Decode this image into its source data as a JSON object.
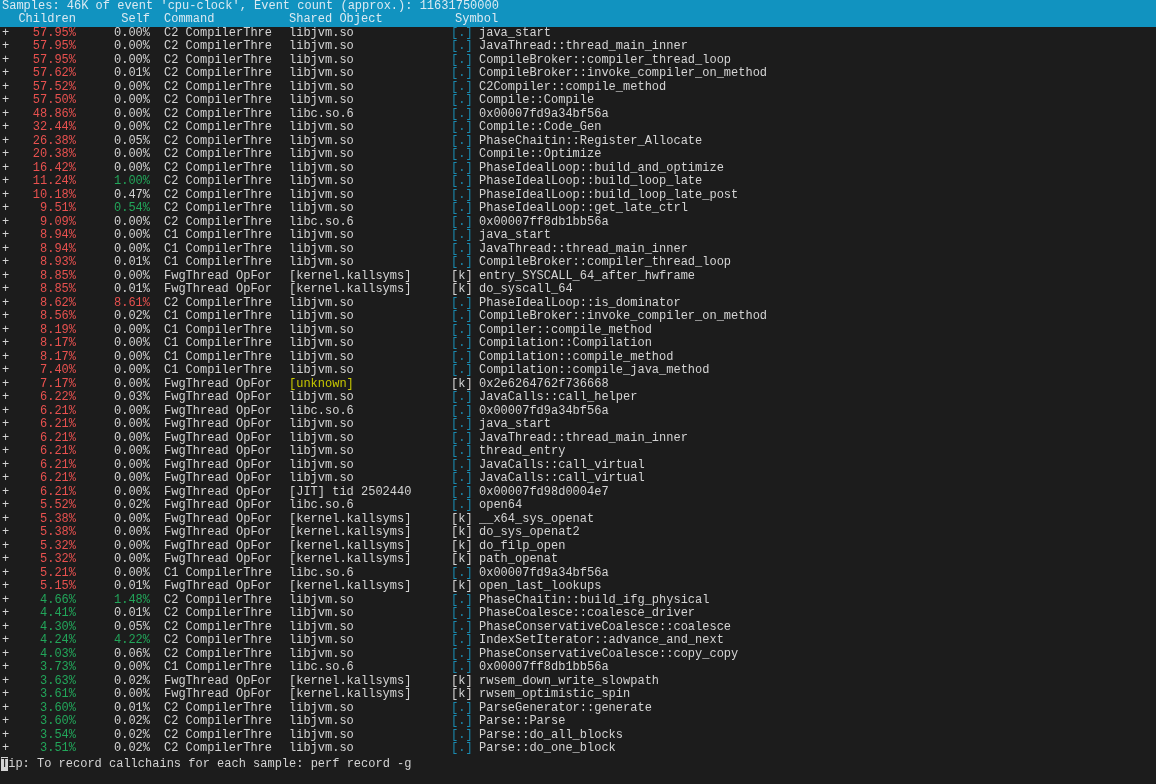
{
  "summary": "Samples: 46K of event 'cpu-clock', Event count (approx.): 11631750000",
  "columns": [
    "Children",
    "Self",
    "Command",
    "Shared Object",
    "Symbol"
  ],
  "rows": [
    {
      "marker": "+",
      "children": "57.95%",
      "children_high": true,
      "self": "0.00%",
      "self_high": false,
      "self_warm": false,
      "command": "C2 CompilerThre",
      "shared_object": "libjvm.so",
      "unknown_object": false,
      "symbol_type": "[.]",
      "kernel": false,
      "symbol": "java_start"
    },
    {
      "marker": "+",
      "children": "57.95%",
      "children_high": true,
      "self": "0.00%",
      "self_high": false,
      "self_warm": false,
      "command": "C2 CompilerThre",
      "shared_object": "libjvm.so",
      "unknown_object": false,
      "symbol_type": "[.]",
      "kernel": false,
      "symbol": "JavaThread::thread_main_inner"
    },
    {
      "marker": "+",
      "children": "57.95%",
      "children_high": true,
      "self": "0.00%",
      "self_high": false,
      "self_warm": false,
      "command": "C2 CompilerThre",
      "shared_object": "libjvm.so",
      "unknown_object": false,
      "symbol_type": "[.]",
      "kernel": false,
      "symbol": "CompileBroker::compiler_thread_loop"
    },
    {
      "marker": "+",
      "children": "57.62%",
      "children_high": true,
      "self": "0.01%",
      "self_high": false,
      "self_warm": false,
      "command": "C2 CompilerThre",
      "shared_object": "libjvm.so",
      "unknown_object": false,
      "symbol_type": "[.]",
      "kernel": false,
      "symbol": "CompileBroker::invoke_compiler_on_method"
    },
    {
      "marker": "+",
      "children": "57.52%",
      "children_high": true,
      "self": "0.00%",
      "self_high": false,
      "self_warm": false,
      "command": "C2 CompilerThre",
      "shared_object": "libjvm.so",
      "unknown_object": false,
      "symbol_type": "[.]",
      "kernel": false,
      "symbol": "C2Compiler::compile_method"
    },
    {
      "marker": "+",
      "children": "57.50%",
      "children_high": true,
      "self": "0.00%",
      "self_high": false,
      "self_warm": false,
      "command": "C2 CompilerThre",
      "shared_object": "libjvm.so",
      "unknown_object": false,
      "symbol_type": "[.]",
      "kernel": false,
      "symbol": "Compile::Compile"
    },
    {
      "marker": "+",
      "children": "48.86%",
      "children_high": true,
      "self": "0.00%",
      "self_high": false,
      "self_warm": false,
      "command": "C2 CompilerThre",
      "shared_object": "libc.so.6",
      "unknown_object": false,
      "symbol_type": "[.]",
      "kernel": false,
      "symbol": "0x00007fd9a34bf56a"
    },
    {
      "marker": "+",
      "children": "32.44%",
      "children_high": true,
      "self": "0.00%",
      "self_high": false,
      "self_warm": false,
      "command": "C2 CompilerThre",
      "shared_object": "libjvm.so",
      "unknown_object": false,
      "symbol_type": "[.]",
      "kernel": false,
      "symbol": "Compile::Code_Gen"
    },
    {
      "marker": "+",
      "children": "26.38%",
      "children_high": true,
      "self": "0.05%",
      "self_high": false,
      "self_warm": false,
      "command": "C2 CompilerThre",
      "shared_object": "libjvm.so",
      "unknown_object": false,
      "symbol_type": "[.]",
      "kernel": false,
      "symbol": "PhaseChaitin::Register_Allocate"
    },
    {
      "marker": "+",
      "children": "20.38%",
      "children_high": true,
      "self": "0.00%",
      "self_high": false,
      "self_warm": false,
      "command": "C2 CompilerThre",
      "shared_object": "libjvm.so",
      "unknown_object": false,
      "symbol_type": "[.]",
      "kernel": false,
      "symbol": "Compile::Optimize"
    },
    {
      "marker": "+",
      "children": "16.42%",
      "children_high": true,
      "self": "0.00%",
      "self_high": false,
      "self_warm": false,
      "command": "C2 CompilerThre",
      "shared_object": "libjvm.so",
      "unknown_object": false,
      "symbol_type": "[.]",
      "kernel": false,
      "symbol": "PhaseIdealLoop::build_and_optimize"
    },
    {
      "marker": "+",
      "children": "11.24%",
      "children_high": true,
      "self": "1.00%",
      "self_high": false,
      "self_warm": true,
      "command": "C2 CompilerThre",
      "shared_object": "libjvm.so",
      "unknown_object": false,
      "symbol_type": "[.]",
      "kernel": false,
      "symbol": "PhaseIdealLoop::build_loop_late"
    },
    {
      "marker": "+",
      "children": "10.18%",
      "children_high": true,
      "self": "0.47%",
      "self_high": false,
      "self_warm": false,
      "command": "C2 CompilerThre",
      "shared_object": "libjvm.so",
      "unknown_object": false,
      "symbol_type": "[.]",
      "kernel": false,
      "symbol": "PhaseIdealLoop::build_loop_late_post"
    },
    {
      "marker": "+",
      "children": "9.51%",
      "children_high": true,
      "self": "0.54%",
      "self_high": false,
      "self_warm": true,
      "command": "C2 CompilerThre",
      "shared_object": "libjvm.so",
      "unknown_object": false,
      "symbol_type": "[.]",
      "kernel": false,
      "symbol": "PhaseIdealLoop::get_late_ctrl"
    },
    {
      "marker": "+",
      "children": "9.09%",
      "children_high": true,
      "self": "0.00%",
      "self_high": false,
      "self_warm": false,
      "command": "C2 CompilerThre",
      "shared_object": "libc.so.6",
      "unknown_object": false,
      "symbol_type": "[.]",
      "kernel": false,
      "symbol": "0x00007ff8db1bb56a"
    },
    {
      "marker": "+",
      "children": "8.94%",
      "children_high": true,
      "self": "0.00%",
      "self_high": false,
      "self_warm": false,
      "command": "C1 CompilerThre",
      "shared_object": "libjvm.so",
      "unknown_object": false,
      "symbol_type": "[.]",
      "kernel": false,
      "symbol": "java_start"
    },
    {
      "marker": "+",
      "children": "8.94%",
      "children_high": true,
      "self": "0.00%",
      "self_high": false,
      "self_warm": false,
      "command": "C1 CompilerThre",
      "shared_object": "libjvm.so",
      "unknown_object": false,
      "symbol_type": "[.]",
      "kernel": false,
      "symbol": "JavaThread::thread_main_inner"
    },
    {
      "marker": "+",
      "children": "8.93%",
      "children_high": true,
      "self": "0.01%",
      "self_high": false,
      "self_warm": false,
      "command": "C1 CompilerThre",
      "shared_object": "libjvm.so",
      "unknown_object": false,
      "symbol_type": "[.]",
      "kernel": false,
      "symbol": "CompileBroker::compiler_thread_loop"
    },
    {
      "marker": "+",
      "children": "8.85%",
      "children_high": true,
      "self": "0.00%",
      "self_high": false,
      "self_warm": false,
      "command": "FwgThread OpFor",
      "shared_object": "[kernel.kallsyms]",
      "unknown_object": false,
      "symbol_type": "[k]",
      "kernel": true,
      "symbol": "entry_SYSCALL_64_after_hwframe"
    },
    {
      "marker": "+",
      "children": "8.85%",
      "children_high": true,
      "self": "0.01%",
      "self_high": false,
      "self_warm": false,
      "command": "FwgThread OpFor",
      "shared_object": "[kernel.kallsyms]",
      "unknown_object": false,
      "symbol_type": "[k]",
      "kernel": true,
      "symbol": "do_syscall_64"
    },
    {
      "marker": "+",
      "children": "8.62%",
      "children_high": true,
      "self": "8.61%",
      "self_high": true,
      "self_warm": false,
      "command": "C2 CompilerThre",
      "shared_object": "libjvm.so",
      "unknown_object": false,
      "symbol_type": "[.]",
      "kernel": false,
      "symbol": "PhaseIdealLoop::is_dominator"
    },
    {
      "marker": "+",
      "children": "8.56%",
      "children_high": true,
      "self": "0.02%",
      "self_high": false,
      "self_warm": false,
      "command": "C1 CompilerThre",
      "shared_object": "libjvm.so",
      "unknown_object": false,
      "symbol_type": "[.]",
      "kernel": false,
      "symbol": "CompileBroker::invoke_compiler_on_method"
    },
    {
      "marker": "+",
      "children": "8.19%",
      "children_high": true,
      "self": "0.00%",
      "self_high": false,
      "self_warm": false,
      "command": "C1 CompilerThre",
      "shared_object": "libjvm.so",
      "unknown_object": false,
      "symbol_type": "[.]",
      "kernel": false,
      "symbol": "Compiler::compile_method"
    },
    {
      "marker": "+",
      "children": "8.17%",
      "children_high": true,
      "self": "0.00%",
      "self_high": false,
      "self_warm": false,
      "command": "C1 CompilerThre",
      "shared_object": "libjvm.so",
      "unknown_object": false,
      "symbol_type": "[.]",
      "kernel": false,
      "symbol": "Compilation::Compilation"
    },
    {
      "marker": "+",
      "children": "8.17%",
      "children_high": true,
      "self": "0.00%",
      "self_high": false,
      "self_warm": false,
      "command": "C1 CompilerThre",
      "shared_object": "libjvm.so",
      "unknown_object": false,
      "symbol_type": "[.]",
      "kernel": false,
      "symbol": "Compilation::compile_method"
    },
    {
      "marker": "+",
      "children": "7.40%",
      "children_high": true,
      "self": "0.00%",
      "self_high": false,
      "self_warm": false,
      "command": "C1 CompilerThre",
      "shared_object": "libjvm.so",
      "unknown_object": false,
      "symbol_type": "[.]",
      "kernel": false,
      "symbol": "Compilation::compile_java_method"
    },
    {
      "marker": "+",
      "children": "7.17%",
      "children_high": true,
      "self": "0.00%",
      "self_high": false,
      "self_warm": false,
      "command": "FwgThread OpFor",
      "shared_object": "[unknown]",
      "unknown_object": true,
      "symbol_type": "[k]",
      "kernel": true,
      "symbol": "0x2e6264762f736668"
    },
    {
      "marker": "+",
      "children": "6.22%",
      "children_high": true,
      "self": "0.03%",
      "self_high": false,
      "self_warm": false,
      "command": "FwgThread OpFor",
      "shared_object": "libjvm.so",
      "unknown_object": false,
      "symbol_type": "[.]",
      "kernel": false,
      "symbol": "JavaCalls::call_helper"
    },
    {
      "marker": "+",
      "children": "6.21%",
      "children_high": true,
      "self": "0.00%",
      "self_high": false,
      "self_warm": false,
      "command": "FwgThread OpFor",
      "shared_object": "libc.so.6",
      "unknown_object": false,
      "symbol_type": "[.]",
      "kernel": false,
      "symbol": "0x00007fd9a34bf56a"
    },
    {
      "marker": "+",
      "children": "6.21%",
      "children_high": true,
      "self": "0.00%",
      "self_high": false,
      "self_warm": false,
      "command": "FwgThread OpFor",
      "shared_object": "libjvm.so",
      "unknown_object": false,
      "symbol_type": "[.]",
      "kernel": false,
      "symbol": "java_start"
    },
    {
      "marker": "+",
      "children": "6.21%",
      "children_high": true,
      "self": "0.00%",
      "self_high": false,
      "self_warm": false,
      "command": "FwgThread OpFor",
      "shared_object": "libjvm.so",
      "unknown_object": false,
      "symbol_type": "[.]",
      "kernel": false,
      "symbol": "JavaThread::thread_main_inner"
    },
    {
      "marker": "+",
      "children": "6.21%",
      "children_high": true,
      "self": "0.00%",
      "self_high": false,
      "self_warm": false,
      "command": "FwgThread OpFor",
      "shared_object": "libjvm.so",
      "unknown_object": false,
      "symbol_type": "[.]",
      "kernel": false,
      "symbol": "thread_entry"
    },
    {
      "marker": "+",
      "children": "6.21%",
      "children_high": true,
      "self": "0.00%",
      "self_high": false,
      "self_warm": false,
      "command": "FwgThread OpFor",
      "shared_object": "libjvm.so",
      "unknown_object": false,
      "symbol_type": "[.]",
      "kernel": false,
      "symbol": "JavaCalls::call_virtual"
    },
    {
      "marker": "+",
      "children": "6.21%",
      "children_high": true,
      "self": "0.00%",
      "self_high": false,
      "self_warm": false,
      "command": "FwgThread OpFor",
      "shared_object": "libjvm.so",
      "unknown_object": false,
      "symbol_type": "[.]",
      "kernel": false,
      "symbol": "JavaCalls::call_virtual"
    },
    {
      "marker": "+",
      "children": "6.21%",
      "children_high": true,
      "self": "0.00%",
      "self_high": false,
      "self_warm": false,
      "command": "FwgThread OpFor",
      "shared_object": "[JIT] tid 2502440",
      "unknown_object": false,
      "symbol_type": "[.]",
      "kernel": false,
      "symbol": "0x00007fd98d0004e7"
    },
    {
      "marker": "+",
      "children": "5.52%",
      "children_high": true,
      "self": "0.02%",
      "self_high": false,
      "self_warm": false,
      "command": "FwgThread OpFor",
      "shared_object": "libc.so.6",
      "unknown_object": false,
      "symbol_type": "[.]",
      "kernel": false,
      "symbol": "open64"
    },
    {
      "marker": "+",
      "children": "5.38%",
      "children_high": true,
      "self": "0.00%",
      "self_high": false,
      "self_warm": false,
      "command": "FwgThread OpFor",
      "shared_object": "[kernel.kallsyms]",
      "unknown_object": false,
      "symbol_type": "[k]",
      "kernel": true,
      "symbol": "__x64_sys_openat"
    },
    {
      "marker": "+",
      "children": "5.38%",
      "children_high": true,
      "self": "0.00%",
      "self_high": false,
      "self_warm": false,
      "command": "FwgThread OpFor",
      "shared_object": "[kernel.kallsyms]",
      "unknown_object": false,
      "symbol_type": "[k]",
      "kernel": true,
      "symbol": "do_sys_openat2"
    },
    {
      "marker": "+",
      "children": "5.32%",
      "children_high": true,
      "self": "0.00%",
      "self_high": false,
      "self_warm": false,
      "command": "FwgThread OpFor",
      "shared_object": "[kernel.kallsyms]",
      "unknown_object": false,
      "symbol_type": "[k]",
      "kernel": true,
      "symbol": "do_filp_open"
    },
    {
      "marker": "+",
      "children": "5.32%",
      "children_high": true,
      "self": "0.00%",
      "self_high": false,
      "self_warm": false,
      "command": "FwgThread OpFor",
      "shared_object": "[kernel.kallsyms]",
      "unknown_object": false,
      "symbol_type": "[k]",
      "kernel": true,
      "symbol": "path_openat"
    },
    {
      "marker": "+",
      "children": "5.21%",
      "children_high": true,
      "self": "0.00%",
      "self_high": false,
      "self_warm": false,
      "command": "C1 CompilerThre",
      "shared_object": "libc.so.6",
      "unknown_object": false,
      "symbol_type": "[.]",
      "kernel": false,
      "symbol": "0x00007fd9a34bf56a"
    },
    {
      "marker": "+",
      "children": "5.15%",
      "children_high": true,
      "self": "0.01%",
      "self_high": false,
      "self_warm": false,
      "command": "FwgThread OpFor",
      "shared_object": "[kernel.kallsyms]",
      "unknown_object": false,
      "symbol_type": "[k]",
      "kernel": true,
      "symbol": "open_last_lookups"
    },
    {
      "marker": "+",
      "children": "4.66%",
      "children_high": false,
      "self": "1.48%",
      "self_high": false,
      "self_warm": true,
      "command": "C2 CompilerThre",
      "shared_object": "libjvm.so",
      "unknown_object": false,
      "symbol_type": "[.]",
      "kernel": false,
      "symbol": "PhaseChaitin::build_ifg_physical"
    },
    {
      "marker": "+",
      "children": "4.41%",
      "children_high": false,
      "self": "0.01%",
      "self_high": false,
      "self_warm": false,
      "command": "C2 CompilerThre",
      "shared_object": "libjvm.so",
      "unknown_object": false,
      "symbol_type": "[.]",
      "kernel": false,
      "symbol": "PhaseCoalesce::coalesce_driver"
    },
    {
      "marker": "+",
      "children": "4.30%",
      "children_high": false,
      "self": "0.05%",
      "self_high": false,
      "self_warm": false,
      "command": "C2 CompilerThre",
      "shared_object": "libjvm.so",
      "unknown_object": false,
      "symbol_type": "[.]",
      "kernel": false,
      "symbol": "PhaseConservativeCoalesce::coalesce"
    },
    {
      "marker": "+",
      "children": "4.24%",
      "children_high": false,
      "self": "4.22%",
      "self_high": false,
      "self_warm": true,
      "command": "C2 CompilerThre",
      "shared_object": "libjvm.so",
      "unknown_object": false,
      "symbol_type": "[.]",
      "kernel": false,
      "symbol": "IndexSetIterator::advance_and_next"
    },
    {
      "marker": "+",
      "children": "4.03%",
      "children_high": false,
      "self": "0.06%",
      "self_high": false,
      "self_warm": false,
      "command": "C2 CompilerThre",
      "shared_object": "libjvm.so",
      "unknown_object": false,
      "symbol_type": "[.]",
      "kernel": false,
      "symbol": "PhaseConservativeCoalesce::copy_copy"
    },
    {
      "marker": "+",
      "children": "3.73%",
      "children_high": false,
      "self": "0.00%",
      "self_high": false,
      "self_warm": false,
      "command": "C1 CompilerThre",
      "shared_object": "libc.so.6",
      "unknown_object": false,
      "symbol_type": "[.]",
      "kernel": false,
      "symbol": "0x00007ff8db1bb56a"
    },
    {
      "marker": "+",
      "children": "3.63%",
      "children_high": false,
      "self": "0.02%",
      "self_high": false,
      "self_warm": false,
      "command": "FwgThread OpFor",
      "shared_object": "[kernel.kallsyms]",
      "unknown_object": false,
      "symbol_type": "[k]",
      "kernel": true,
      "symbol": "rwsem_down_write_slowpath"
    },
    {
      "marker": "+",
      "children": "3.61%",
      "children_high": false,
      "self": "0.00%",
      "self_high": false,
      "self_warm": false,
      "command": "FwgThread OpFor",
      "shared_object": "[kernel.kallsyms]",
      "unknown_object": false,
      "symbol_type": "[k]",
      "kernel": true,
      "symbol": "rwsem_optimistic_spin"
    },
    {
      "marker": "+",
      "children": "3.60%",
      "children_high": false,
      "self": "0.01%",
      "self_high": false,
      "self_warm": false,
      "command": "C2 CompilerThre",
      "shared_object": "libjvm.so",
      "unknown_object": false,
      "symbol_type": "[.]",
      "kernel": false,
      "symbol": "ParseGenerator::generate"
    },
    {
      "marker": "+",
      "children": "3.60%",
      "children_high": false,
      "self": "0.02%",
      "self_high": false,
      "self_warm": false,
      "command": "C2 CompilerThre",
      "shared_object": "libjvm.so",
      "unknown_object": false,
      "symbol_type": "[.]",
      "kernel": false,
      "symbol": "Parse::Parse"
    },
    {
      "marker": "+",
      "children": "3.54%",
      "children_high": false,
      "self": "0.02%",
      "self_high": false,
      "self_warm": false,
      "command": "C2 CompilerThre",
      "shared_object": "libjvm.so",
      "unknown_object": false,
      "symbol_type": "[.]",
      "kernel": false,
      "symbol": "Parse::do_all_blocks"
    },
    {
      "marker": "+",
      "children": "3.51%",
      "children_high": false,
      "self": "0.02%",
      "self_high": false,
      "self_warm": false,
      "command": "C2 CompilerThre",
      "shared_object": "libjvm.so",
      "unknown_object": false,
      "symbol_type": "[.]",
      "kernel": false,
      "symbol": "Parse::do_one_block"
    }
  ],
  "status_bar": {
    "text": "Tip: To record callchains for each sample: perf record -g",
    "cursor": true
  }
}
